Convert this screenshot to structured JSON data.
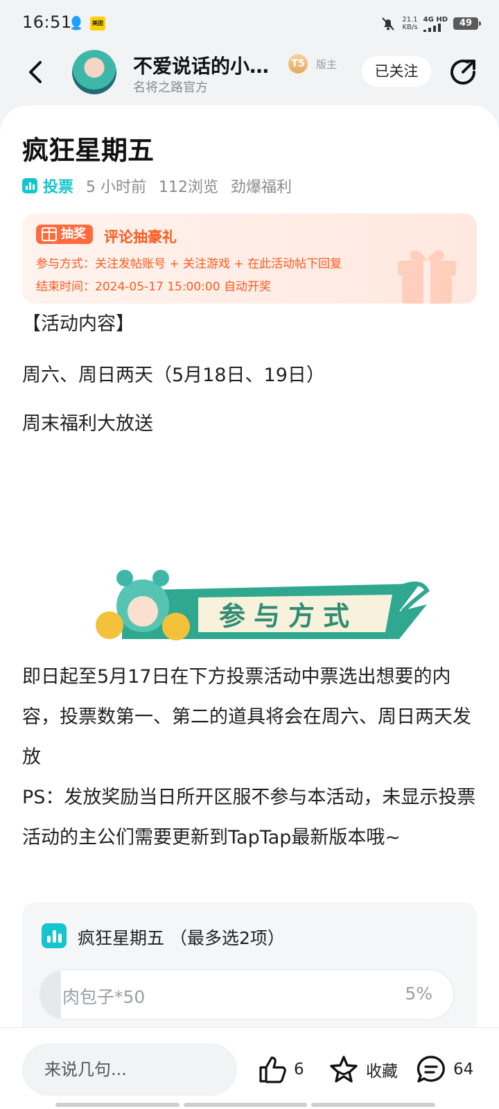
{
  "status_bar": {
    "time": "16:51",
    "meituan_label": "美团",
    "net_speed_value": "21.1",
    "net_speed_unit": "KB/s",
    "signal": "4G HD",
    "battery": "49"
  },
  "header": {
    "author_name": "不爱说话的小…",
    "author_sub": "名将之路官方",
    "level": "T5",
    "role_tag": "版主",
    "follow_label": "已关注"
  },
  "post": {
    "title": "疯狂星期五",
    "type_label": "投票",
    "time_ago": "5 小时前",
    "views": "112浏览",
    "category": "劲爆福利"
  },
  "lottery": {
    "tag": "抽奖",
    "title": "评论抽豪礼",
    "method": "参与方式：关注发帖账号 + 关注游戏 + 在此活动帖下回复",
    "end_time": "结束时间：2024-05-17 15:00:00 自动开奖"
  },
  "content": {
    "section_heading": "【活动内容】",
    "days": "周六、周日两天（5月18日、19日）",
    "weekend": "周末福利大放送",
    "banner_text": "参与方式",
    "body": "即日起至5月17日在下方投票活动中票选出想要的内容，投票数第一、第二的道具将会在周六、周日两天发放",
    "ps": "PS：发放奖励当日所开区服不参与本活动，未显示投票活动的主公们需要更新到TapTap最新版本哦~"
  },
  "poll": {
    "title": "疯狂星期五 （最多选2项）",
    "options": [
      {
        "label": "肉包子*50",
        "percent": "5%",
        "fraction": 0.05
      }
    ]
  },
  "bottom_bar": {
    "comment_placeholder": "来说几句...",
    "likes": "6",
    "favorite_label": "收藏",
    "comments": "64"
  },
  "colors": {
    "accent_teal": "#15c5ce",
    "lottery_orange": "#ff5a1f",
    "banner_green": "#2fa88f"
  }
}
